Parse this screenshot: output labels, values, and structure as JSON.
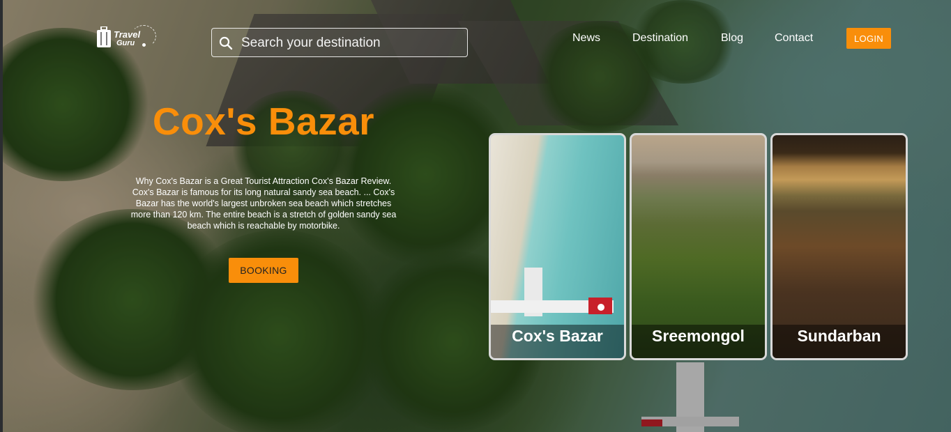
{
  "brand": {
    "line1": "Travel",
    "line2": "Guru"
  },
  "search": {
    "placeholder": "Search your destination"
  },
  "nav": {
    "items": [
      "News",
      "Destination",
      "Blog",
      "Contact"
    ]
  },
  "login_label": "LOGIN",
  "hero": {
    "title": "Cox's Bazar",
    "description": "Why Cox's Bazar is a Great Tourist Attraction Cox's Bazar Review. Cox's Bazar is famous for its long natural sandy sea beach. ... Cox's Bazar has the world's largest unbroken sea beach which stretches more than 120 km. The entire beach is a stretch of golden sandy sea beach which is reachable by motorbike.",
    "button": "BOOKING"
  },
  "cards": [
    {
      "title": "Cox's Bazar"
    },
    {
      "title": "Sreemongol"
    },
    {
      "title": "Sundarban"
    }
  ],
  "colors": {
    "accent": "#f98e0a",
    "text": "#ffffff",
    "card_border": "#d9d9d9"
  },
  "icons": {
    "search": "search-icon",
    "logo": "luggage-icon"
  }
}
